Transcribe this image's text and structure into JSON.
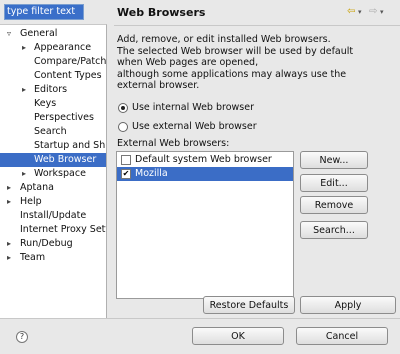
{
  "filter": {
    "value": "type filter text"
  },
  "tree": {
    "nodes": [
      {
        "label": "General",
        "twisty": "▿",
        "level": 0
      },
      {
        "label": "Appearance",
        "twisty": "▸",
        "level": 1
      },
      {
        "label": "Compare/Patch",
        "twisty": "",
        "level": 1
      },
      {
        "label": "Content Types",
        "twisty": "",
        "level": 1
      },
      {
        "label": "Editors",
        "twisty": "▸",
        "level": 1
      },
      {
        "label": "Keys",
        "twisty": "",
        "level": 1
      },
      {
        "label": "Perspectives",
        "twisty": "",
        "level": 1
      },
      {
        "label": "Search",
        "twisty": "",
        "level": 1
      },
      {
        "label": "Startup and Shu",
        "twisty": "",
        "level": 1
      },
      {
        "label": "Web Browser",
        "twisty": "",
        "level": 1,
        "selected": true
      },
      {
        "label": "Workspace",
        "twisty": "▸",
        "level": 1
      },
      {
        "label": "Aptana",
        "twisty": "▸",
        "level": 0
      },
      {
        "label": "Help",
        "twisty": "▸",
        "level": 0
      },
      {
        "label": "Install/Update",
        "twisty": "",
        "level": 0
      },
      {
        "label": "Internet Proxy Sett",
        "twisty": "",
        "level": 0
      },
      {
        "label": "Run/Debug",
        "twisty": "▸",
        "level": 0
      },
      {
        "label": "Team",
        "twisty": "▸",
        "level": 0
      }
    ]
  },
  "page": {
    "title": "Web Browsers",
    "description": [
      "Add, remove, or edit installed Web browsers.",
      "The selected Web browser will be used by default",
      "when Web pages are opened,",
      "although some applications may always use the",
      "external browser."
    ],
    "radio_internal": "Use internal Web browser",
    "radio_external": "Use external Web browser",
    "selected_mode": "internal",
    "external_label": "External Web browsers:",
    "browsers": [
      {
        "name": "Default system Web browser",
        "checked": false,
        "selected": false
      },
      {
        "name": "Mozilla",
        "checked": true,
        "selected": true
      }
    ]
  },
  "buttons": {
    "new": "New...",
    "edit": "Edit...",
    "remove": "Remove",
    "search": "Search...",
    "restore": "Restore Defaults",
    "apply": "Apply",
    "ok": "OK",
    "cancel": "Cancel"
  },
  "icons": {
    "back": "back-arrow-icon",
    "forward": "forward-arrow-icon",
    "help": "help-icon"
  }
}
